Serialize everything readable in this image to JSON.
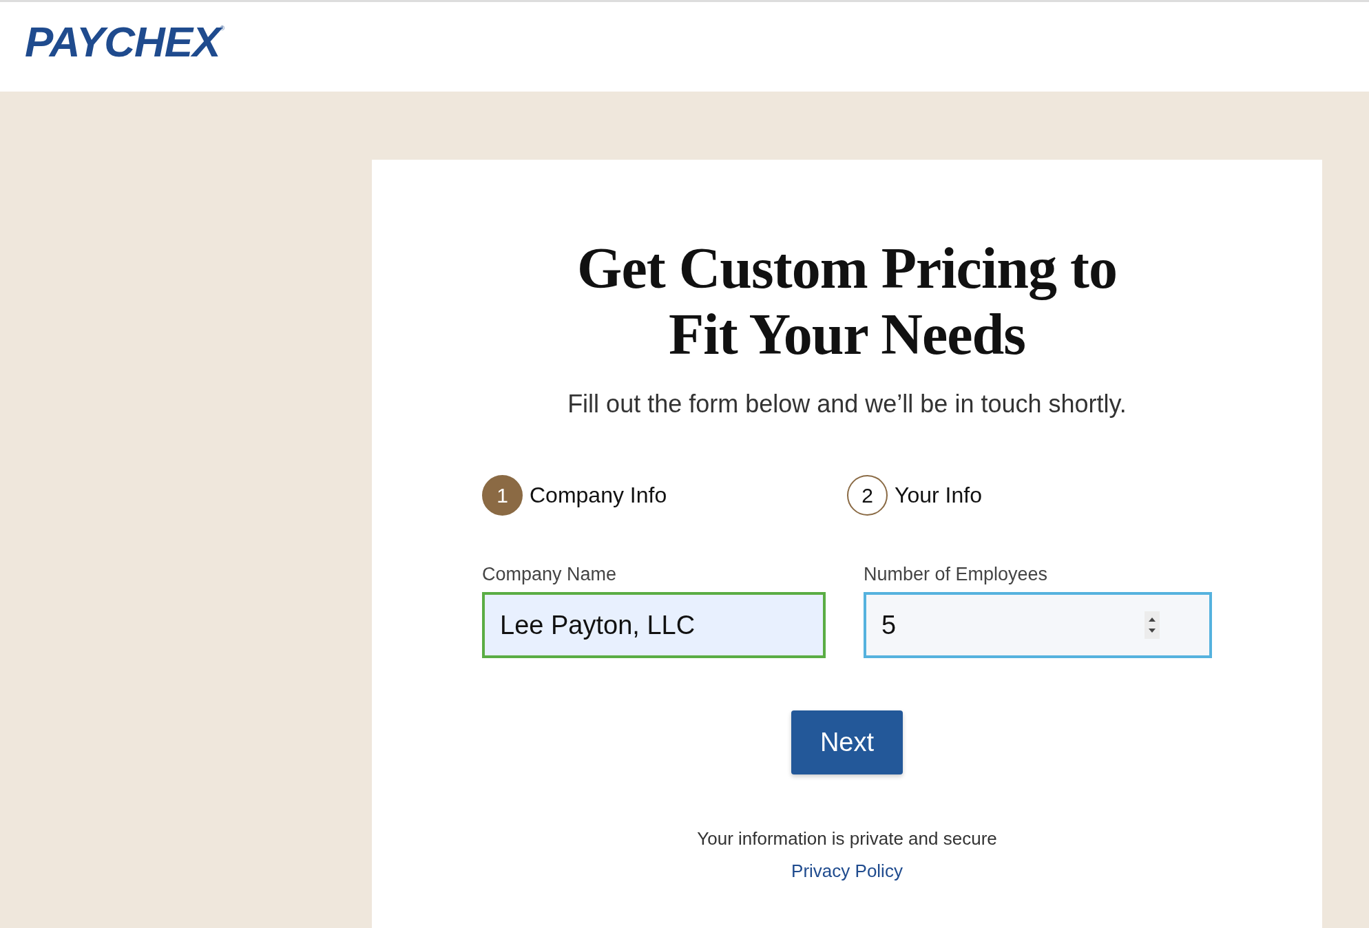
{
  "header": {
    "logo": "PAYCHEX$^{®}$"
  },
  "form": {
    "title": "Get Custom Pricing to Fit Your Needs",
    "subtitle": "Fill out the form below and we’ll be in touch shortly.",
    "steps": [
      {
        "number": "1",
        "label": "Company Info",
        "selected": true
      },
      {
        "number": "2",
        "label": "Your Info",
        "selected": false
      }
    ],
    "fields": [
      {
        "label": "Company Name",
        "value": "Lee Payton, LLC",
        "kind": "text",
        "valid": true,
        "focused": false
      },
      {
        "label": "Number of Employees",
        "value": "5",
        "kind": "number",
        "valid": false,
        "focused": true
      }
    ],
    "button": "Next",
    "note": "Your information is private and secure",
    "link": "Privacy Policy"
  }
}
